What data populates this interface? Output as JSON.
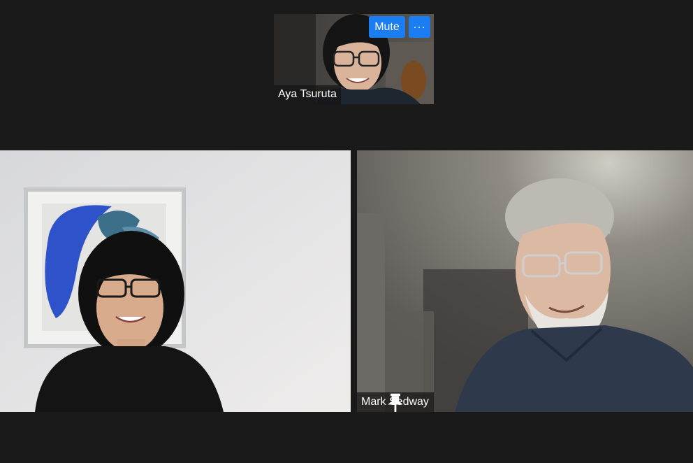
{
  "participants": [
    {
      "name": "Aya Tsuruta",
      "controls": {
        "mute_label": "Mute",
        "more_label": "···"
      }
    },
    {
      "name": ""
    },
    {
      "name": "Mark Sedway",
      "pinned_icon": "pin-icon"
    }
  ],
  "colors": {
    "background": "#1a1a1a",
    "button_accent": "#1a7df1",
    "label_bg": "#141414"
  }
}
